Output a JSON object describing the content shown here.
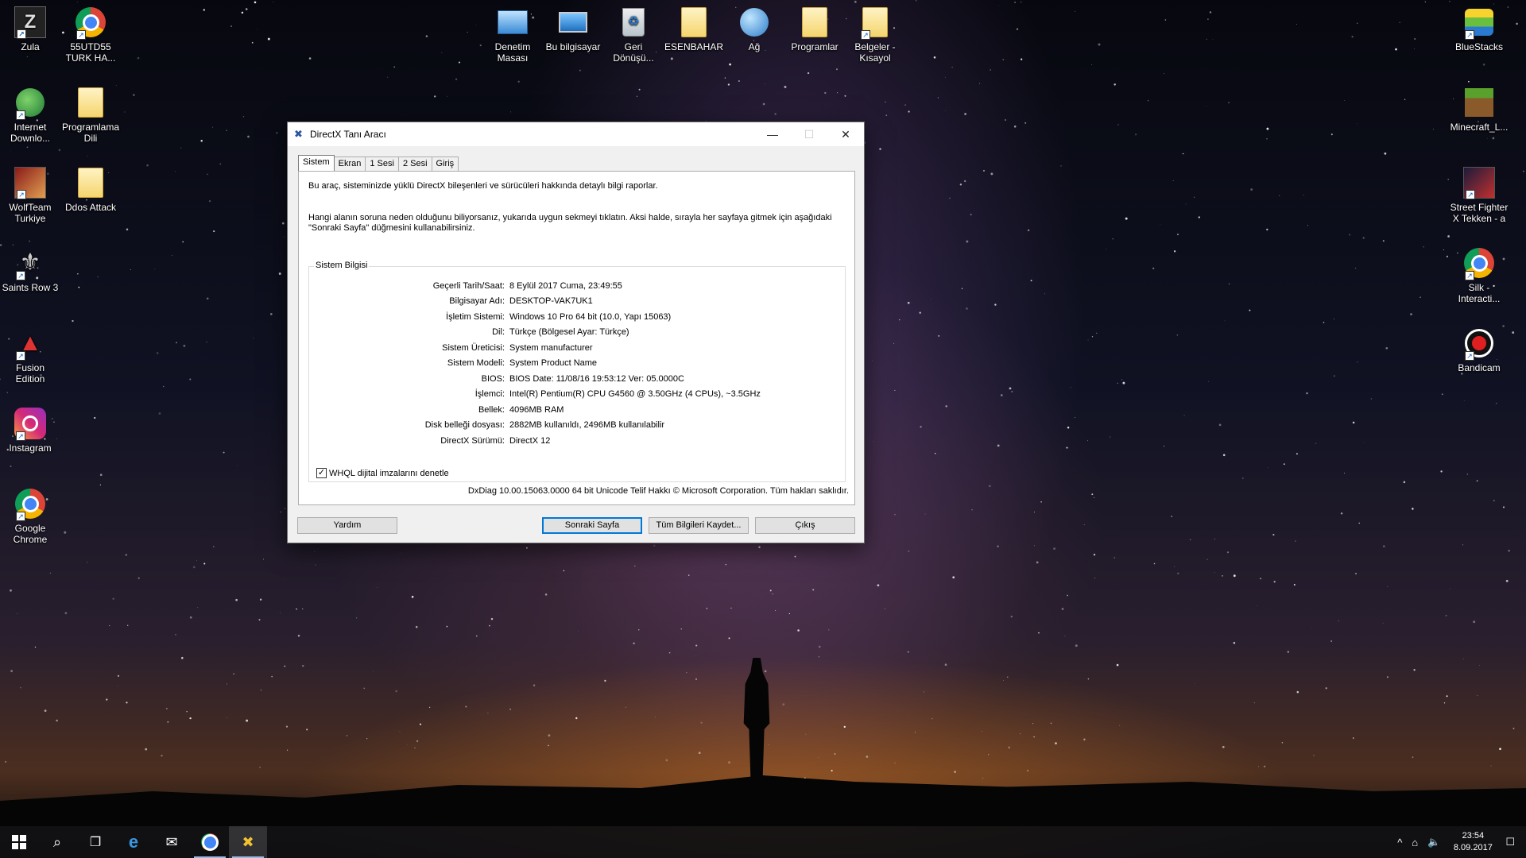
{
  "desktop": {
    "left_icons": [
      {
        "label": "Zula",
        "icon": "zula-game-icon"
      },
      {
        "label": "55UTD55\nTURK HA...",
        "icon": "chrome-icon"
      },
      {
        "label": "Internet\nDownlo...",
        "icon": "internet-download-manager-icon"
      },
      {
        "label": "Programlama\nDili",
        "icon": "folder-icon"
      },
      {
        "label": "WolfTeam\nTurkiye",
        "icon": "wolfteam-game-icon"
      },
      {
        "label": "Ddos Attack",
        "icon": "folder-icon"
      },
      {
        "label": "Saints Row 3",
        "icon": "saints-row-game-icon"
      },
      {
        "label": "Fusion\nEdition",
        "icon": "fusion-game-icon"
      },
      {
        "label": "Instagram",
        "icon": "instagram-icon"
      },
      {
        "label": "Google\nChrome",
        "icon": "chrome-icon"
      }
    ],
    "top_icons": [
      {
        "label": "Denetim\nMasası",
        "icon": "control-panel-icon"
      },
      {
        "label": "Bu bilgisayar",
        "icon": "this-pc-icon"
      },
      {
        "label": "Geri\nDönüşü...",
        "icon": "recycle-bin-icon"
      },
      {
        "label": "ESENBAHAR",
        "icon": "user-folder-icon"
      },
      {
        "label": "Ağ",
        "icon": "network-icon"
      },
      {
        "label": "Programlar",
        "icon": "programs-folder-icon"
      },
      {
        "label": "Belgeler -\nKısayol",
        "icon": "documents-shortcut-icon"
      }
    ],
    "right_icons": [
      {
        "label": "BlueStacks",
        "icon": "bluestacks-icon"
      },
      {
        "label": "Minecraft_L...",
        "icon": "minecraft-icon"
      },
      {
        "label": "Street Fighter\nX Tekken - a",
        "icon": "street-fighter-icon"
      },
      {
        "label": "Silk -\nInteracti...",
        "icon": "chrome-icon"
      },
      {
        "label": "Bandicam",
        "icon": "bandicam-icon"
      }
    ]
  },
  "dialog": {
    "title": "DirectX Tanı Aracı",
    "tabs": [
      "Sistem",
      "Ekran",
      "1 Sesi",
      "2 Sesi",
      "Giriş"
    ],
    "active_tab": "Sistem",
    "intro1": "Bu araç, sisteminizde yüklü DirectX bileşenleri ve sürücüleri hakkında detaylı bilgi raporlar.",
    "intro2": "Hangi alanın soruna neden olduğunu biliyorsanız, yukarıda uygun sekmeyi tıklatın. Aksi halde, sırayla her sayfaya gitmek için aşağıdaki \"Sonraki Sayfa\" düğmesini kullanabilirsiniz.",
    "group_title": "Sistem Bilgisi",
    "rows": [
      {
        "key": "Geçerli Tarih/Saat:",
        "value": "8 Eylül 2017 Cuma, 23:49:55"
      },
      {
        "key": "Bilgisayar Adı:",
        "value": "DESKTOP-VAK7UK1"
      },
      {
        "key": "İşletim Sistemi:",
        "value": "Windows 10 Pro 64 bit (10.0, Yapı 15063)"
      },
      {
        "key": "Dil:",
        "value": "Türkçe (Bölgesel Ayar: Türkçe)"
      },
      {
        "key": "Sistem Üreticisi:",
        "value": "System manufacturer"
      },
      {
        "key": "Sistem Modeli:",
        "value": "System Product Name"
      },
      {
        "key": "BIOS:",
        "value": "BIOS Date: 11/08/16 19:53:12 Ver: 05.0000C"
      },
      {
        "key": "İşlemci:",
        "value": "Intel(R) Pentium(R) CPU G4560 @ 3.50GHz (4 CPUs), ~3.5GHz"
      },
      {
        "key": "Bellek:",
        "value": "4096MB RAM"
      },
      {
        "key": "Disk belleği dosyası:",
        "value": "2882MB kullanıldı, 2496MB kullanılabilir"
      },
      {
        "key": "DirectX Sürümü:",
        "value": "DirectX 12"
      }
    ],
    "checkbox_label": "WHQL dijital imzalarını denetle",
    "checkbox_checked": true,
    "footer_note": "DxDiag 10.00.15063.0000 64 bit Unicode  Telif Hakkı © Microsoft Corporation. Tüm hakları saklıdır.",
    "buttons": {
      "help": "Yardım",
      "next": "Sonraki Sayfa",
      "save": "Tüm Bilgileri Kaydet...",
      "exit": "Çıkış"
    },
    "window_controls": {
      "minimize": "—",
      "maximize": "☐",
      "close": "✕"
    }
  },
  "taskbar": {
    "time": "23:54",
    "date": "8.09.2017"
  }
}
